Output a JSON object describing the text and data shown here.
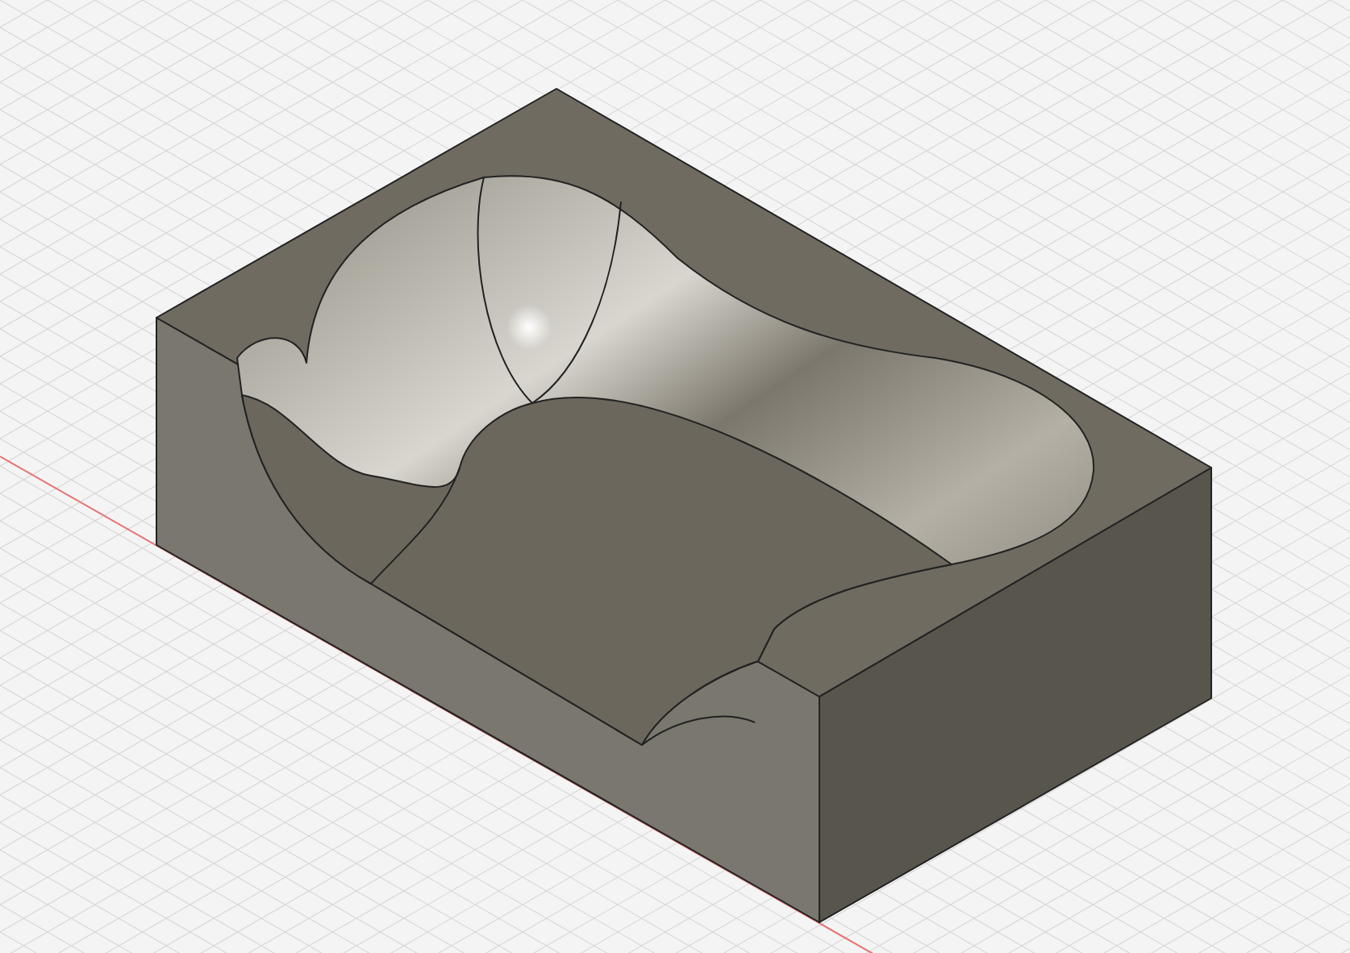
{
  "viewport": {
    "show_grid": true,
    "show_axis": true
  }
}
